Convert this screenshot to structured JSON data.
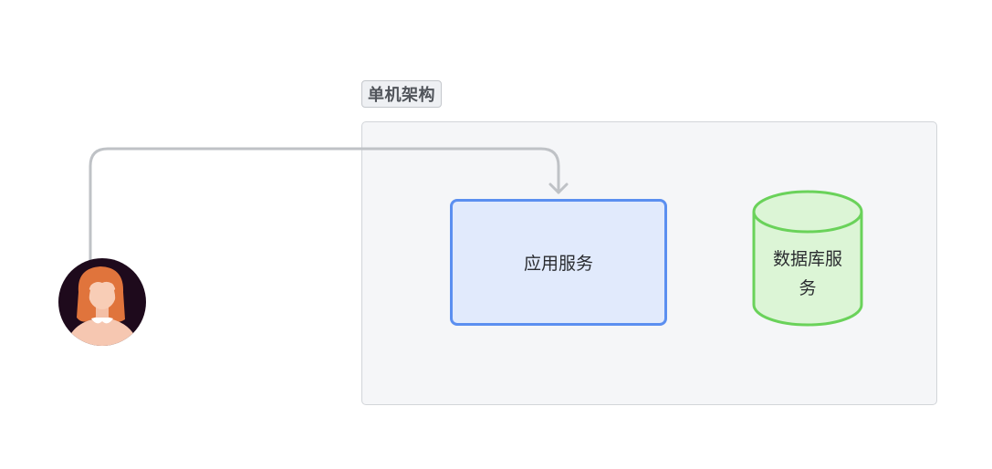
{
  "diagram": {
    "group": {
      "label": "单机架构"
    },
    "nodes": {
      "app_service": {
        "label": "应用服务",
        "fill": "#e1eafc",
        "stroke": "#5b8ff0"
      },
      "db_service": {
        "label_line1": "数据库服",
        "label_line2": "务",
        "fill": "#dcf5d6",
        "stroke": "#6ad25a"
      },
      "user": {
        "icon": "user-avatar-icon"
      }
    },
    "edges": [
      {
        "from": "user",
        "to": "app_service",
        "color": "#bfc2c6"
      }
    ]
  }
}
